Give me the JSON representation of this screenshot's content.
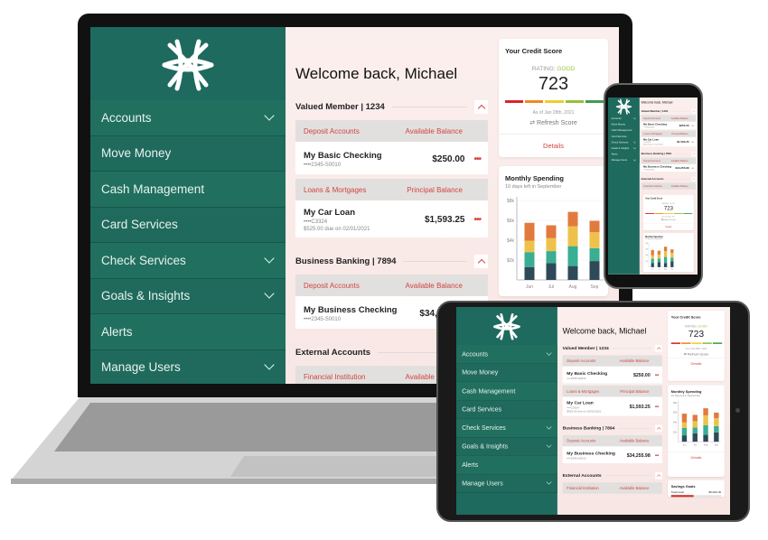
{
  "app": {
    "sidebar": {
      "items": [
        {
          "label": "Accounts",
          "chevron": true
        },
        {
          "label": "Move Money",
          "chevron": false
        },
        {
          "label": "Cash Management",
          "chevron": false
        },
        {
          "label": "Card Services",
          "chevron": false
        },
        {
          "label": "Check Services",
          "chevron": true
        },
        {
          "label": "Goals & Insights",
          "chevron": true
        },
        {
          "label": "Alerts",
          "chevron": false
        },
        {
          "label": "Manage Users",
          "chevron": true
        }
      ]
    },
    "welcome": "Welcome back, Michael",
    "sections": [
      {
        "title": "Valued Member | 1234",
        "tables": [
          {
            "header_left": "Deposit Accounts",
            "header_right": "Available Balance",
            "rows": [
              {
                "name": "My Basic Checking",
                "number": "••••2345-S0010",
                "amount": "$250.00"
              }
            ]
          },
          {
            "header_left": "Loans & Mortgages",
            "header_right": "Principal Balance",
            "rows": [
              {
                "name": "My Car Loan",
                "number": "••••C3324",
                "extra": "$525.00 due on 02/01/2021",
                "amount": "$1,593.25"
              }
            ]
          }
        ]
      },
      {
        "title": "Business Banking | 7894",
        "tables": [
          {
            "header_left": "Deposit Accounts",
            "header_right": "Available Balance",
            "rows": [
              {
                "name": "My Business Checking",
                "number": "••••2345-S0010",
                "amount": "$34,255.98"
              }
            ]
          }
        ]
      },
      {
        "title": "External Accounts",
        "tables": [
          {
            "header_left": "Financial Institution",
            "header_right": "Available Balance",
            "rows": []
          }
        ]
      }
    ],
    "credit": {
      "title": "Your Credit Score",
      "rating_label": "RATING: ",
      "rating": "GOOD",
      "score": "723",
      "as_of": "As of Jan 28th, 2021",
      "refresh": "⇄ Refresh Score",
      "details": "Details",
      "scale_colors": [
        "#d9262b",
        "#ef8a1f",
        "#f0cd2b",
        "#93c03c",
        "#3f9e4d"
      ]
    },
    "spending": {
      "title": "Monthly Spending",
      "subtitle": "10 days left in September",
      "details": "Details"
    },
    "savings": {
      "title": "Savings Goals",
      "label": "Total Goal",
      "amount": "$5,000.00",
      "progress": 0.45
    },
    "colors": {
      "sidebar": "#1e6a5f",
      "accent": "#d0453f",
      "background": "#fbecea"
    }
  },
  "chart_data": {
    "type": "bar",
    "stacked": true,
    "categories": [
      "Jun",
      "Jul",
      "Aug",
      "Sep"
    ],
    "y_ticks": [
      "$2k",
      "$4k",
      "$6k",
      "$8k"
    ],
    "ylim": [
      0,
      8000
    ],
    "grid": true,
    "series": [
      {
        "color": "#2e4a58",
        "values": [
          1300,
          1700,
          1400,
          1900
        ]
      },
      {
        "color": "#3aae93",
        "values": [
          1500,
          1200,
          2000,
          1300
        ]
      },
      {
        "color": "#eec24a",
        "values": [
          1150,
          1300,
          2000,
          1600
        ]
      },
      {
        "color": "#e27a3e",
        "values": [
          1800,
          1300,
          1450,
          1150
        ]
      }
    ]
  }
}
